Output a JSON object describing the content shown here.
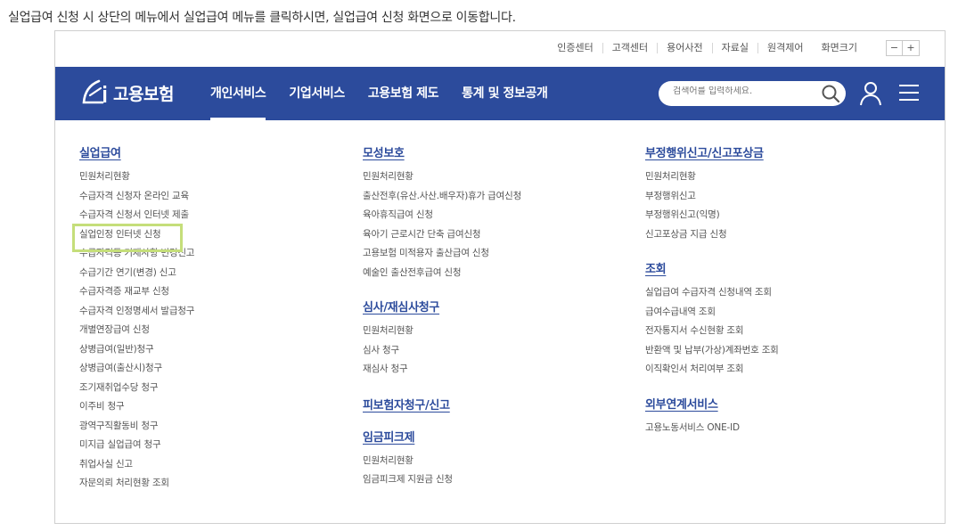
{
  "caption": "실업급여 신청 시 상단의 메뉴에서 실업급여 메뉴를 클릭하시면, 실업급여 신청 화면으로 이동합니다.",
  "utility": {
    "links": [
      "인증센터",
      "고객센터",
      "용어사전",
      "자료실",
      "원격제어"
    ],
    "zoom_label": "화면크기",
    "zoom_minus": "−",
    "zoom_plus": "+"
  },
  "logo": {
    "text": "고용보험"
  },
  "nav": {
    "items": [
      "개인서비스",
      "기업서비스",
      "고용보험 제도",
      "통계 및 정보공개"
    ],
    "active_index": 0
  },
  "search": {
    "placeholder": "검색어를 입력하세요."
  },
  "columns": {
    "col1": {
      "sections": [
        {
          "title": "실업급여",
          "items": [
            "민원처리현황",
            "수급자격 신청자 온라인 교육",
            "수급자격 신청서 인터넷 제출",
            "실업인정 인터넷 신청",
            "수급자격등 기재사항 변경신고",
            "수급기간 연기(변경) 신고",
            "수급자격증 재교부 신청",
            "수급자격 인정명세서 발급청구",
            "개별연장급여 신청",
            "상병급여(일반)청구",
            "상병급여(출산시)청구",
            "조기재취업수당 청구",
            "이주비 청구",
            "광역구직활동비 청구",
            "미지급 실업급여 청구",
            "취업사실 신고",
            "자문의뢰 처리현황 조회"
          ]
        }
      ]
    },
    "col2": {
      "sections": [
        {
          "title": "모성보호",
          "items": [
            "민원처리현황",
            "출산전후(유산.사산.배우자)휴가 급여신청",
            "육아휴직급여 신청",
            "육아기 근로시간 단축 급여신청",
            "고용보험 미적용자 출산급여 신청",
            "예술인 출산전후급여 신청"
          ]
        },
        {
          "title": "심사/재심사청구",
          "items": [
            "민원처리현황",
            "심사 청구",
            "재심사 청구"
          ]
        },
        {
          "title": "피보험자청구/신고",
          "items": []
        },
        {
          "title": "임금피크제",
          "items": [
            "민원처리현황",
            "임금피크제 지원금 신청"
          ]
        }
      ]
    },
    "col3": {
      "sections": [
        {
          "title": "부정행위신고/신고포상금",
          "items": [
            "민원처리현황",
            "부정행위신고",
            "부정행위신고(익명)",
            "신고포상금 지급 신청"
          ]
        },
        {
          "title": "조회",
          "items": [
            "실업급여 수급자격 신청내역 조회",
            "급여수급내역 조회",
            "전자통지서 수신현황 조회",
            "반환액 및 납부(가상)계좌번호 조회",
            "이직확인서 처리여부 조회"
          ]
        },
        {
          "title": "외부연계서비스",
          "items": [
            "고용노동서비스 ONE-ID"
          ]
        }
      ]
    }
  },
  "highlight": {
    "target": "실업인정 인터넷 신청",
    "color": "#c5de7a"
  },
  "colors": {
    "brand": "#2c4b9c",
    "highlight": "#c5de7a"
  }
}
